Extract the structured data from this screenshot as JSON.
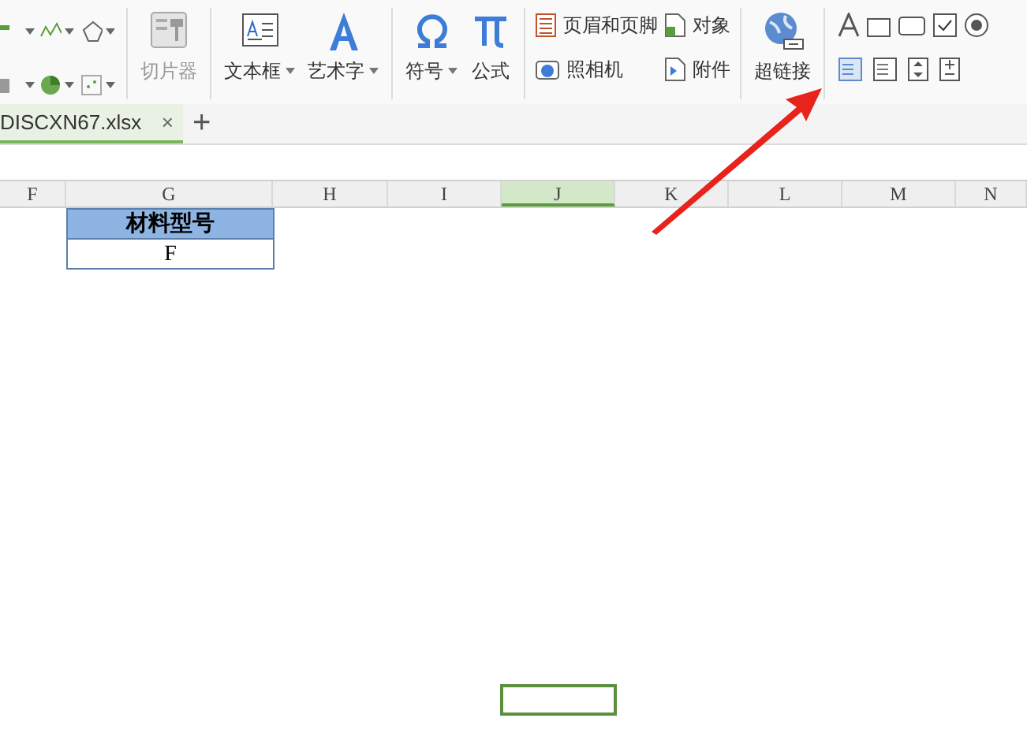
{
  "ribbon": [
    {
      "kind": "chart_grid"
    },
    {
      "kind": "separator"
    },
    {
      "kind": "large",
      "label": "切片器",
      "disabled": true,
      "dropdown": false
    },
    {
      "kind": "separator"
    },
    {
      "kind": "large",
      "label": "文本框",
      "disabled": false,
      "dropdown": true
    },
    {
      "kind": "large",
      "label": "艺术字",
      "disabled": false,
      "dropdown": true
    },
    {
      "kind": "separator"
    },
    {
      "kind": "large",
      "label": "符号",
      "disabled": false,
      "dropdown": true
    },
    {
      "kind": "large",
      "label": "公式",
      "disabled": false,
      "dropdown": false
    },
    {
      "kind": "separator"
    },
    {
      "kind": "small_stack",
      "labels": [
        "页眉和页脚",
        "照相机"
      ]
    },
    {
      "kind": "small_stack",
      "labels": [
        "对象",
        "附件"
      ]
    },
    {
      "kind": "separator"
    },
    {
      "kind": "large",
      "label": "超链接",
      "disabled": false,
      "dropdown": false
    },
    {
      "kind": "separator"
    },
    {
      "kind": "control_grid"
    }
  ],
  "tabs": [
    {
      "label": "DISCXN67.xlsx",
      "close": "×",
      "selected": true
    }
  ],
  "new_tab": "+",
  "columns": [
    {
      "label": "F",
      "selected": false
    },
    {
      "label": "G",
      "selected": false,
      "cells": [
        {
          "text": "材料型号",
          "kind": "header"
        },
        {
          "text": "F",
          "kind": "value"
        }
      ]
    },
    {
      "label": "H",
      "selected": false
    },
    {
      "label": "I",
      "selected": false
    },
    {
      "label": "J",
      "selected": true
    },
    {
      "label": "K",
      "selected": false
    },
    {
      "label": "L",
      "selected": false
    },
    {
      "label": "M",
      "selected": false
    },
    {
      "label": "N",
      "selected": false
    }
  ]
}
